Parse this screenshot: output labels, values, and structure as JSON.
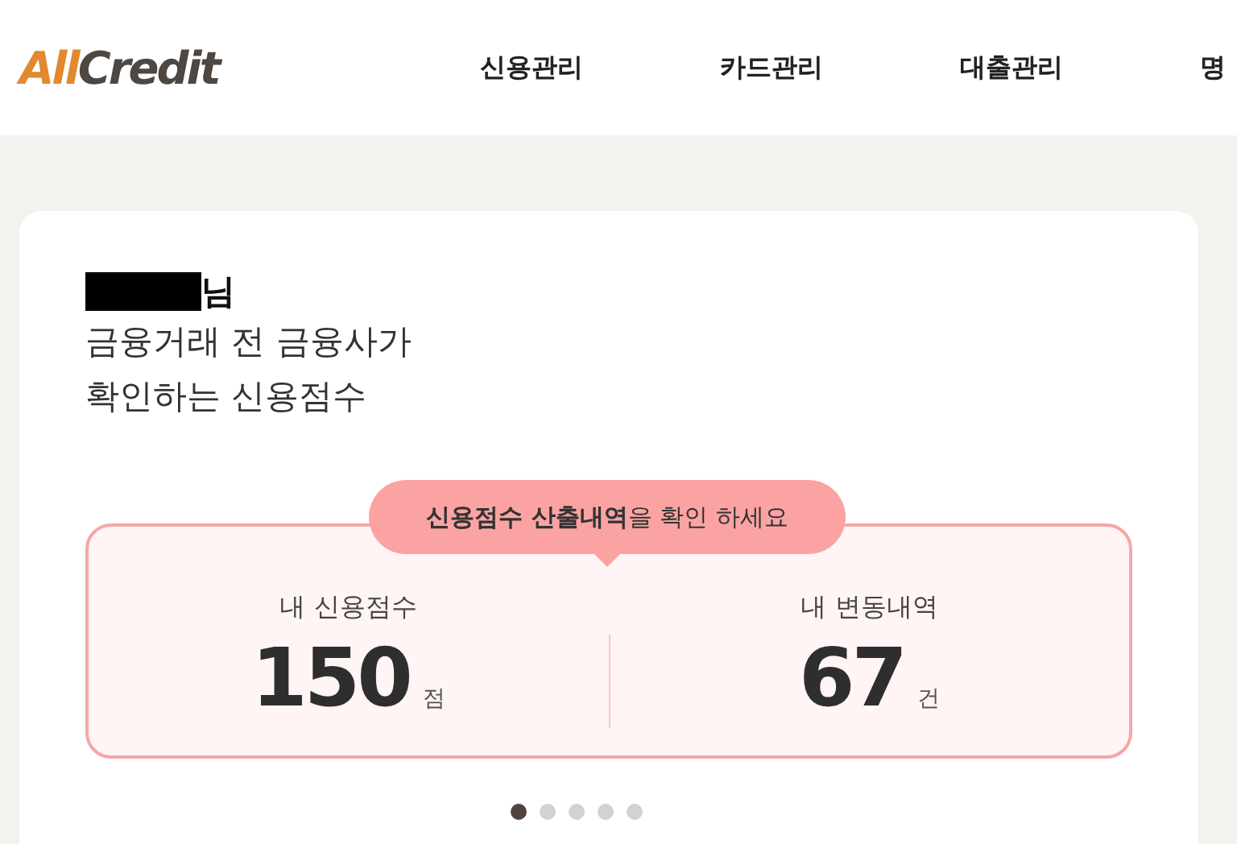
{
  "logo": {
    "accent": "All",
    "rest": "Credit"
  },
  "nav": [
    {
      "label": "신용관리"
    },
    {
      "label": "카드관리"
    },
    {
      "label": "대출관리"
    },
    {
      "label": "명"
    }
  ],
  "greeting": {
    "name_redacted": true,
    "suffix": "님",
    "lines": [
      "금융거래 전 금융사가",
      "확인하는 신용점수"
    ]
  },
  "callout": "**신용점수 산출내역**을 확인 하세요",
  "stats": [
    {
      "label": "내 신용점수",
      "value": "150",
      "unit": "점"
    },
    {
      "label": "내 변동내역",
      "value": "67",
      "unit": "건"
    }
  ],
  "pager": [
    {
      "selected": true
    },
    {
      "selected": false
    },
    {
      "selected": false
    },
    {
      "selected": false
    },
    {
      "selected": false
    }
  ]
}
